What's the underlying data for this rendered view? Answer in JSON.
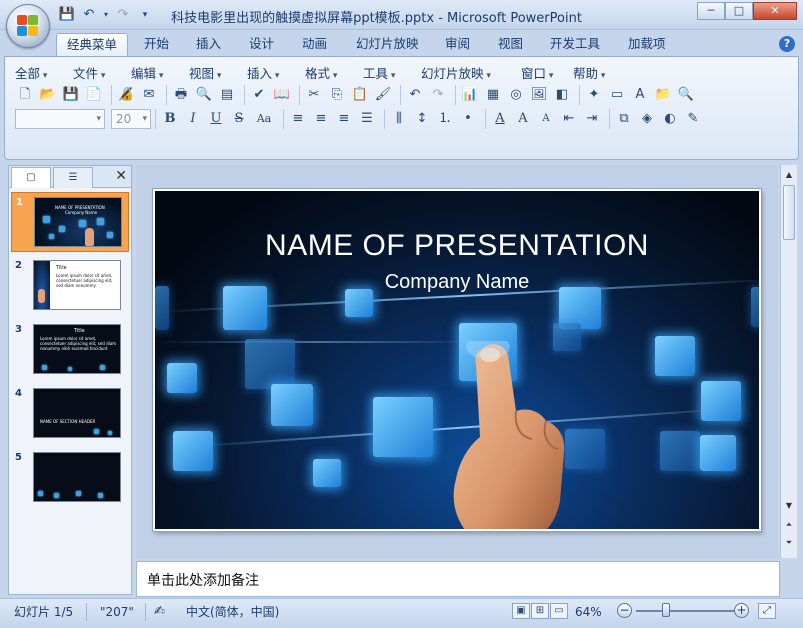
{
  "window": {
    "title": "科技电影里出现的触摸虚拟屏幕ppt模板.pptx - Microsoft PowerPoint",
    "minimize_label": "─",
    "maximize_label": "□",
    "close_label": "✕"
  },
  "tabs": [
    "经典菜单",
    "开始",
    "插入",
    "设计",
    "动画",
    "幻灯片放映",
    "审阅",
    "视图",
    "开发工具",
    "加载项"
  ],
  "active_tab": "经典菜单",
  "help_label": "?",
  "menu": [
    "全部",
    "文件",
    "编辑",
    "视图",
    "插入",
    "格式",
    "工具",
    "幻灯片放映",
    "窗口",
    "帮助"
  ],
  "font_size_value": "20",
  "thumbnails": {
    "tab_slides_label": "▢",
    "tab_outline_label": "☰",
    "close_label": "✕",
    "items": [
      {
        "number": "1",
        "title": "NAME OF PRESENTATION",
        "subtitle": "Company Name"
      },
      {
        "number": "2",
        "title": "Title",
        "subtitle": "Lorem ipsum dolor sit amet, consectetuer adipiscing elit, sed diam nonummy"
      },
      {
        "number": "3",
        "title": "Title",
        "subtitle": "Lorem ipsum dolor sit amet, consectetuer adipiscing elit, sed diam nonummy nibh euismod tincidunt"
      },
      {
        "number": "4",
        "title": "NAME OF SECTION HEADER",
        "subtitle": ""
      },
      {
        "number": "5",
        "title": "",
        "subtitle": ""
      }
    ]
  },
  "slide": {
    "title": "NAME OF PRESENTATION",
    "subtitle": "Company Name"
  },
  "notes_placeholder": "单击此处添加备注",
  "status": {
    "slide_count": "幻灯片 1/5",
    "theme": "\"207\"",
    "language": "中文(简体，中国)",
    "zoom": "64%",
    "zoom_fraction": 0.3
  },
  "colors": {
    "selected_thumb": "#f6a44f",
    "ribbon": "#dbe7f6",
    "slide_bg": "#050b16",
    "tile_glow": "#3fa0e6"
  }
}
